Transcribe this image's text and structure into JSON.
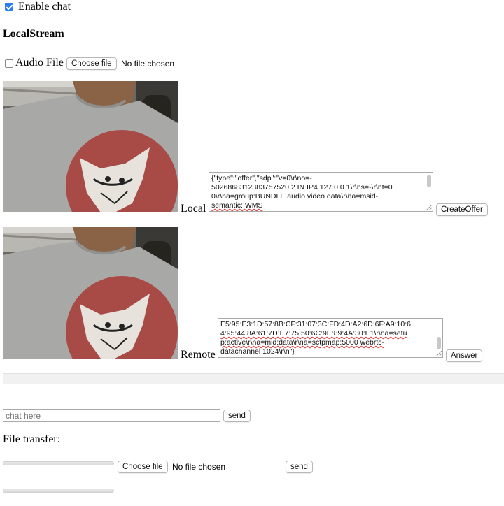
{
  "enable_chat": {
    "label": "Enable chat",
    "checked": true
  },
  "local_stream_heading": "LocalStream",
  "audio_file": {
    "label": "Audio File",
    "choose_label": "Choose file",
    "status": "No file chosen",
    "checked": false
  },
  "local": {
    "label": "Local",
    "sdp_line1": "{\"type\":\"offer\",\"sdp\":\"v=0\\r\\no=-",
    "sdp_line2": "5026868312383757520 2 IN IP4 127.0.0.1\\r\\ns=-\\r\\nt=0",
    "sdp_line3": "0\\r\\na=group:BUNDLE audio video data\\r\\na=msid-",
    "sdp_line4": "semantic: WMS",
    "button": "CreateOffer"
  },
  "remote": {
    "label": "Remote",
    "sdp_line1": "E5:95:E3:1D:57:8B:CF:31:07:3C:FD:4D:A2:6D:6F:A9:10:6",
    "sdp_line2": "4:95:44:8A:61:7D:E7:75:50:6C:9E:89:4A:30:E1\\r\\na=setu",
    "sdp_line3": "p:active\\r\\na=mid:data\\r\\na=sctpmap:5000 webrtc-",
    "sdp_line4": "datachannel 1024\\r\\n\"}",
    "button": "Answer"
  },
  "chat": {
    "placeholder": "chat here",
    "send": "send"
  },
  "file_transfer": {
    "heading": "File transfer:",
    "choose_label": "Choose file",
    "status": "No file chosen",
    "send": "send"
  },
  "colors": {
    "accent": "#2a7ff0",
    "tshirt": "#a9a9a7",
    "circle": "#a84a45"
  }
}
